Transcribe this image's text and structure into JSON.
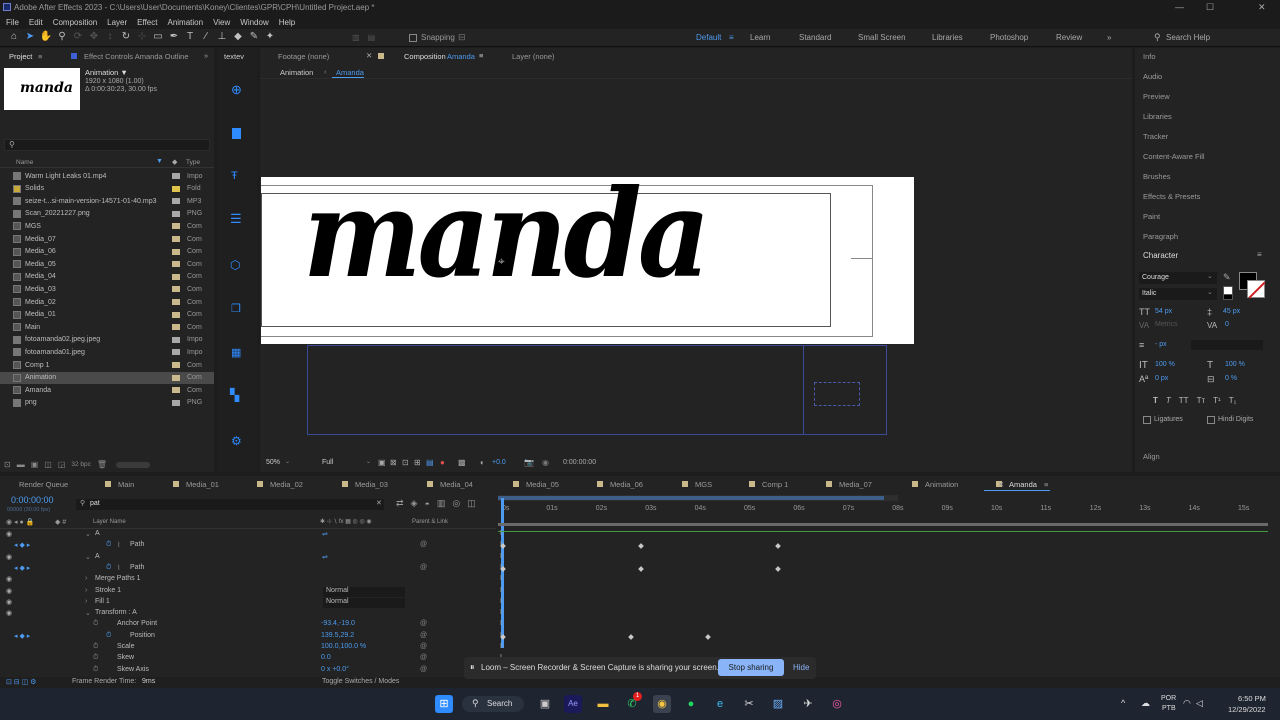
{
  "window": {
    "title": "Adobe After Effects 2023 - C:\\Users\\User\\Documents\\Koney\\Clientes\\GPR\\CPH\\Untitled Project.aep *",
    "minimize": "—",
    "maximize": "☐",
    "close": "✕"
  },
  "menu": [
    "File",
    "Edit",
    "Composition",
    "Layer",
    "Effect",
    "Animation",
    "View",
    "Window",
    "Help"
  ],
  "toolbar": {
    "snapping_label": "Snapping",
    "workspaces": [
      "Default",
      "Learn",
      "Standard",
      "Small Screen",
      "Libraries",
      "Photoshop",
      "Review"
    ],
    "more": "»",
    "search_placeholder": "Search Help"
  },
  "project_panel": {
    "tab_project": "Project",
    "tab_effects": "Effect Controls Amanda Outline",
    "tab_extra": "textev",
    "more": "»",
    "thumb_text": "manda",
    "selected_name": "Animation ▼",
    "selected_dims": "1920 x 1080 (1.00)",
    "selected_duration": "Δ 0:00:30:23, 30.00 fps",
    "search_placeholder": "",
    "col_name": "Name",
    "col_type": "Type",
    "items": [
      {
        "name": "Warm Light Leaks 01.mp4",
        "type": "Impo",
        "color": "#a8a8a8",
        "icon": "file"
      },
      {
        "name": "Solids",
        "type": "Fold",
        "color": "#e0c34a",
        "icon": "folder"
      },
      {
        "name": "seize-t...si-main-version-14571-01-40.mp3",
        "type": "MP3",
        "color": "#a8a8a8",
        "icon": "file"
      },
      {
        "name": "Scan_20221227.png",
        "type": "PNG",
        "color": "#a8a8a8",
        "icon": "file"
      },
      {
        "name": "MGS",
        "type": "Com",
        "color": "#c9b98a",
        "icon": "comp"
      },
      {
        "name": "Media_07",
        "type": "Com",
        "color": "#c9b98a",
        "icon": "comp"
      },
      {
        "name": "Media_06",
        "type": "Com",
        "color": "#c9b98a",
        "icon": "comp"
      },
      {
        "name": "Media_05",
        "type": "Com",
        "color": "#c9b98a",
        "icon": "comp"
      },
      {
        "name": "Media_04",
        "type": "Com",
        "color": "#c9b98a",
        "icon": "comp"
      },
      {
        "name": "Media_03",
        "type": "Com",
        "color": "#c9b98a",
        "icon": "comp"
      },
      {
        "name": "Media_02",
        "type": "Com",
        "color": "#c9b98a",
        "icon": "comp"
      },
      {
        "name": "Media_01",
        "type": "Com",
        "color": "#c9b98a",
        "icon": "comp"
      },
      {
        "name": "Main",
        "type": "Com",
        "color": "#c9b98a",
        "icon": "comp"
      },
      {
        "name": "fotoamanda02.jpeg.jpeg",
        "type": "Impo",
        "color": "#a8a8a8",
        "icon": "file"
      },
      {
        "name": "fotoamanda01.jpeg",
        "type": "Impo",
        "color": "#a8a8a8",
        "icon": "file"
      },
      {
        "name": "Comp 1",
        "type": "Com",
        "color": "#c9b98a",
        "icon": "comp"
      },
      {
        "name": "Animation",
        "type": "Com",
        "color": "#c9b98a",
        "icon": "comp"
      },
      {
        "name": "Amanda",
        "type": "Com",
        "color": "#c9b98a",
        "icon": "comp"
      },
      {
        "name": "png",
        "type": "PNG",
        "color": "#a8a8a8",
        "icon": "file"
      }
    ],
    "bpc": "32 bpc"
  },
  "viewer": {
    "tab_footage": "Footage (none)",
    "tab_comp_prefix": "Composition",
    "tab_comp_name": "Amanda",
    "tab_layer": "Layer (none)",
    "breadcrumb_1": "Animation",
    "breadcrumb_2": "Amanda",
    "canvas_text": "manda",
    "zoom": "50%",
    "resolution": "Full",
    "exposure": "+0.0",
    "timecode": "0:00:00:00"
  },
  "right_panel": {
    "items": [
      "Info",
      "Audio",
      "Preview",
      "Libraries",
      "Tracker",
      "Content-Aware Fill",
      "Brushes",
      "Effects & Presets",
      "Paint",
      "Paragraph"
    ],
    "character_title": "Character",
    "font": "Courage",
    "style": "Italic",
    "font_size": "54 px",
    "leading": "45 px",
    "tracking_label": "Metrics",
    "tracking": "0",
    "stroke": "- px",
    "vscale": "100 %",
    "hscale": "100 %",
    "baseline": "0 px",
    "tsume": "0 %",
    "ligatures": "Ligatures",
    "hindi_digits": "Hindi Digits",
    "align": "Align"
  },
  "timeline": {
    "tabs": [
      "Render Queue",
      "Main",
      "Media_01",
      "Media_02",
      "Media_03",
      "Media_04",
      "Media_05",
      "Media_06",
      "MGS",
      "Comp 1",
      "Media_07",
      "Animation",
      "Amanda"
    ],
    "timecode": "0:00:00:00",
    "timecode_sub": "00000 (30.00 fps)",
    "search_value": "pat",
    "col_layer_name": "Layer Name",
    "col_parent": "Parent & Link",
    "ruler": [
      "0s",
      "01s",
      "02s",
      "03s",
      "04s",
      "05s",
      "06s",
      "07s",
      "08s",
      "09s",
      "10s",
      "11s",
      "12s",
      "13s",
      "14s",
      "15s"
    ],
    "rows": [
      {
        "name": "A",
        "indent": 95,
        "value": "",
        "mode": ""
      },
      {
        "name": "Path",
        "indent": 130,
        "value": "",
        "mode": ""
      },
      {
        "name": "A",
        "indent": 95,
        "value": "",
        "mode": ""
      },
      {
        "name": "Path",
        "indent": 130,
        "value": "",
        "mode": ""
      },
      {
        "name": "Merge Paths 1",
        "indent": 95,
        "value": "",
        "mode": ""
      },
      {
        "name": "Stroke 1",
        "indent": 95,
        "value": "",
        "mode": "Normal"
      },
      {
        "name": "Fill 1",
        "indent": 95,
        "value": "",
        "mode": "Normal"
      },
      {
        "name": "Transform : A",
        "indent": 95,
        "value": "",
        "mode": ""
      },
      {
        "name": "Anchor Point",
        "indent": 117,
        "value": "-93.4,-19.0",
        "mode": ""
      },
      {
        "name": "Position",
        "indent": 130,
        "value": "139.5,29.2",
        "mode": ""
      },
      {
        "name": "Scale",
        "indent": 117,
        "value": "100.0,100.0 %",
        "mode": ""
      },
      {
        "name": "Skew",
        "indent": 117,
        "value": "0.0",
        "mode": ""
      },
      {
        "name": "Skew Axis",
        "indent": 117,
        "value": "0 x +0.0°",
        "mode": ""
      }
    ],
    "render_time_label": "Frame Render Time:",
    "render_time": "9ms",
    "toggle_label": "Toggle Switches / Modes"
  },
  "loom_bar": {
    "message": "Loom – Screen Recorder & Screen Capture is sharing your screen.",
    "stop": "Stop sharing",
    "hide": "Hide"
  },
  "taskbar": {
    "search": "Search",
    "lang_1": "POR",
    "lang_2": "PTB",
    "time": "6:50 PM",
    "date": "12/29/2022",
    "badge": "1"
  }
}
